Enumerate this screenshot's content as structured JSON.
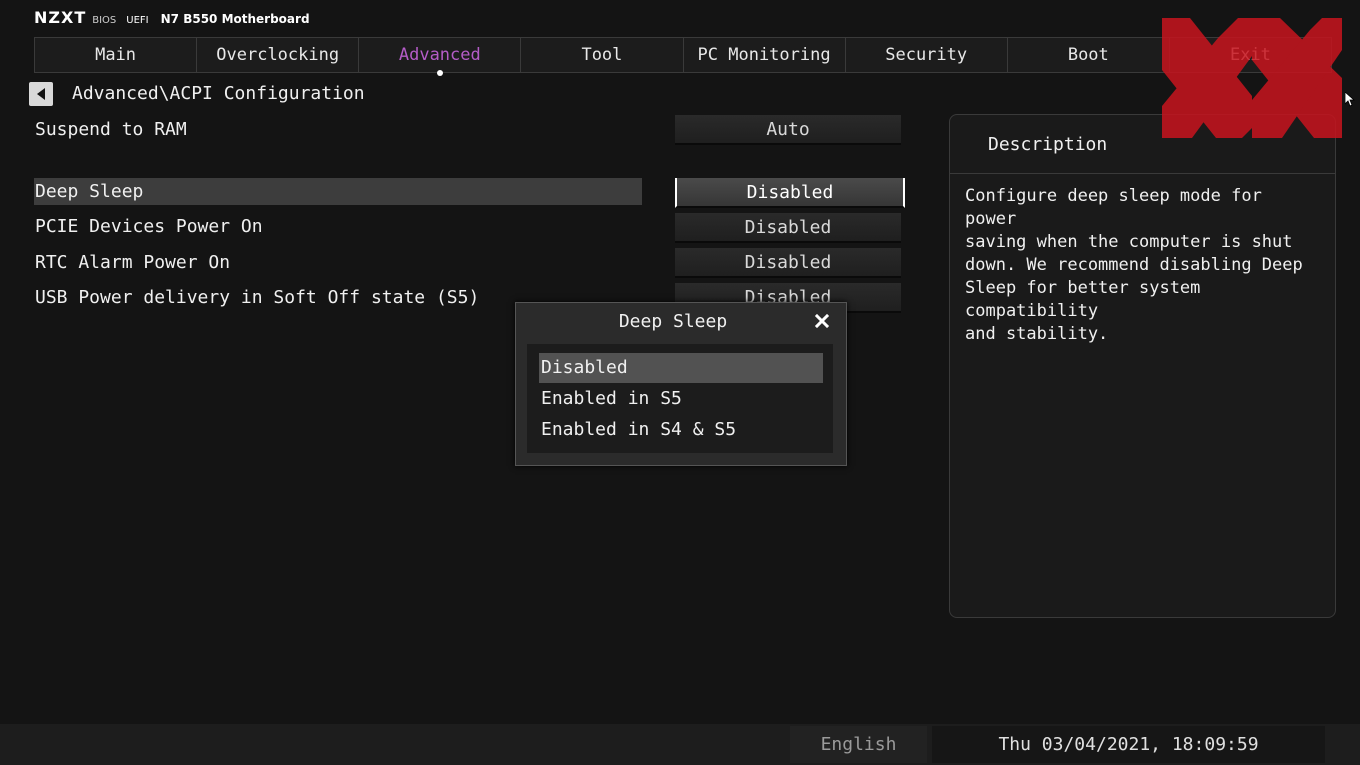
{
  "header": {
    "brand": "NZXT",
    "bios_label": "BIOS",
    "uefi_label": "UEFI",
    "model": "N7 B550 Motherboard"
  },
  "tabs": [
    {
      "label": "Main"
    },
    {
      "label": "Overclocking"
    },
    {
      "label": "Advanced"
    },
    {
      "label": "Tool"
    },
    {
      "label": "PC Monitoring"
    },
    {
      "label": "Security"
    },
    {
      "label": "Boot"
    },
    {
      "label": "Exit"
    }
  ],
  "active_tab": "Advanced",
  "breadcrumb": "Advanced\\ACPI Configuration",
  "settings": [
    {
      "label": "Suspend to RAM",
      "value": "Auto"
    },
    {
      "label": "Deep Sleep",
      "value": "Disabled"
    },
    {
      "label": "PCIE Devices Power On",
      "value": "Disabled"
    },
    {
      "label": "RTC Alarm Power On",
      "value": "Disabled"
    },
    {
      "label": "USB Power delivery in Soft Off state (S5)",
      "value": "Disabled"
    }
  ],
  "description": {
    "title": "Description",
    "text": "Configure deep sleep mode for power\nsaving when the computer is shut\ndown. We recommend disabling Deep\nSleep for better system compatibility\nand stability."
  },
  "modal": {
    "title": "Deep Sleep",
    "options": [
      "Disabled",
      "Enabled in S5",
      "Enabled in S4 & S5"
    ],
    "selected": "Disabled"
  },
  "footer": {
    "language": "English",
    "datetime": "Thu 03/04/2021, 18:09:59"
  },
  "colors": {
    "accent": "#b45cc7",
    "background": "#141414",
    "logo_red": "#c8141e"
  },
  "icons": {
    "back": "triangle-left-icon",
    "close": "x-icon",
    "cursor": "mouse-pointer-icon",
    "watermark": "xx-logo"
  }
}
